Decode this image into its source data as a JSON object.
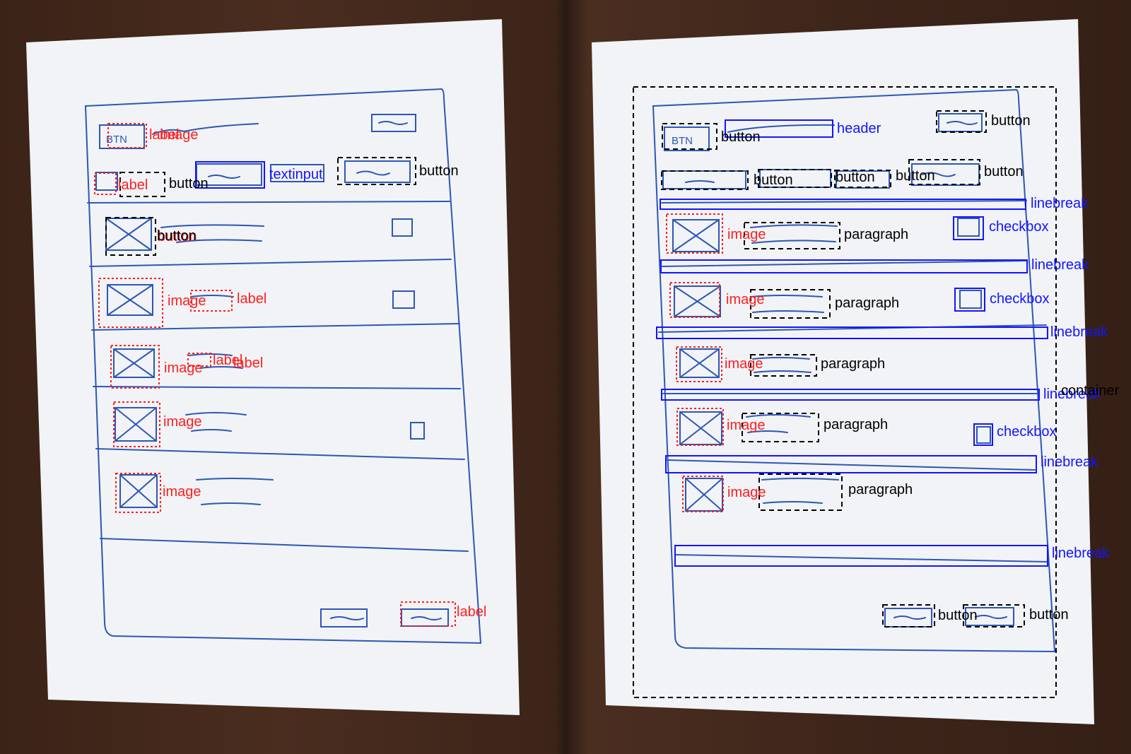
{
  "left_panel": {
    "labels": {
      "label_top_overlap": "label",
      "image_top_overlap": "image",
      "label_nav": "label",
      "button_nav": "button",
      "textinput": "textinput",
      "button_top_right": "button",
      "button_row1": "button",
      "button_row1_overlap": "button",
      "image_row2": "image",
      "label_row2": "label",
      "image_row3": "image",
      "label_row3a": "label",
      "label_row3b": "label",
      "image_row4": "image",
      "image_row5": "image",
      "label_bottom": "label"
    }
  },
  "right_panel": {
    "labels": {
      "button_btn": "button",
      "header": "header",
      "button_top_right": "button",
      "button_nav1": "button",
      "button_nav2": "button",
      "button_nav3": "button",
      "button_nav4": "button",
      "linebreak1": "linebreak",
      "image_row1": "image",
      "paragraph_row1": "paragraph",
      "checkbox_row1": "checkbox",
      "linebreak2": "linebreak",
      "image_row2": "image",
      "paragraph_row2": "paragraph",
      "checkbox_row2": "checkbox",
      "linebreak3": "linebreak",
      "image_row3": "image",
      "paragraph_row3": "paragraph",
      "linebreak4": "linebreak",
      "container": "container",
      "image_row4": "image",
      "paragraph_row4": "paragraph",
      "checkbox_row4": "checkbox",
      "linebreak5": "linebreak",
      "image_row5": "image",
      "paragraph_row5": "paragraph",
      "linebreak6": "linebreak",
      "button_bottom1": "button",
      "button_bottom2": "button"
    }
  },
  "sketch_text": {
    "btn_left": "BTN",
    "btn_right": "BTN"
  },
  "colors": {
    "paper": "#f1f3f6",
    "ink": "#2d57b5",
    "detection_red": "#ff1e1e",
    "detection_blue": "#1414ff",
    "detection_black": "#000000",
    "background_wood": "#3d2419"
  }
}
